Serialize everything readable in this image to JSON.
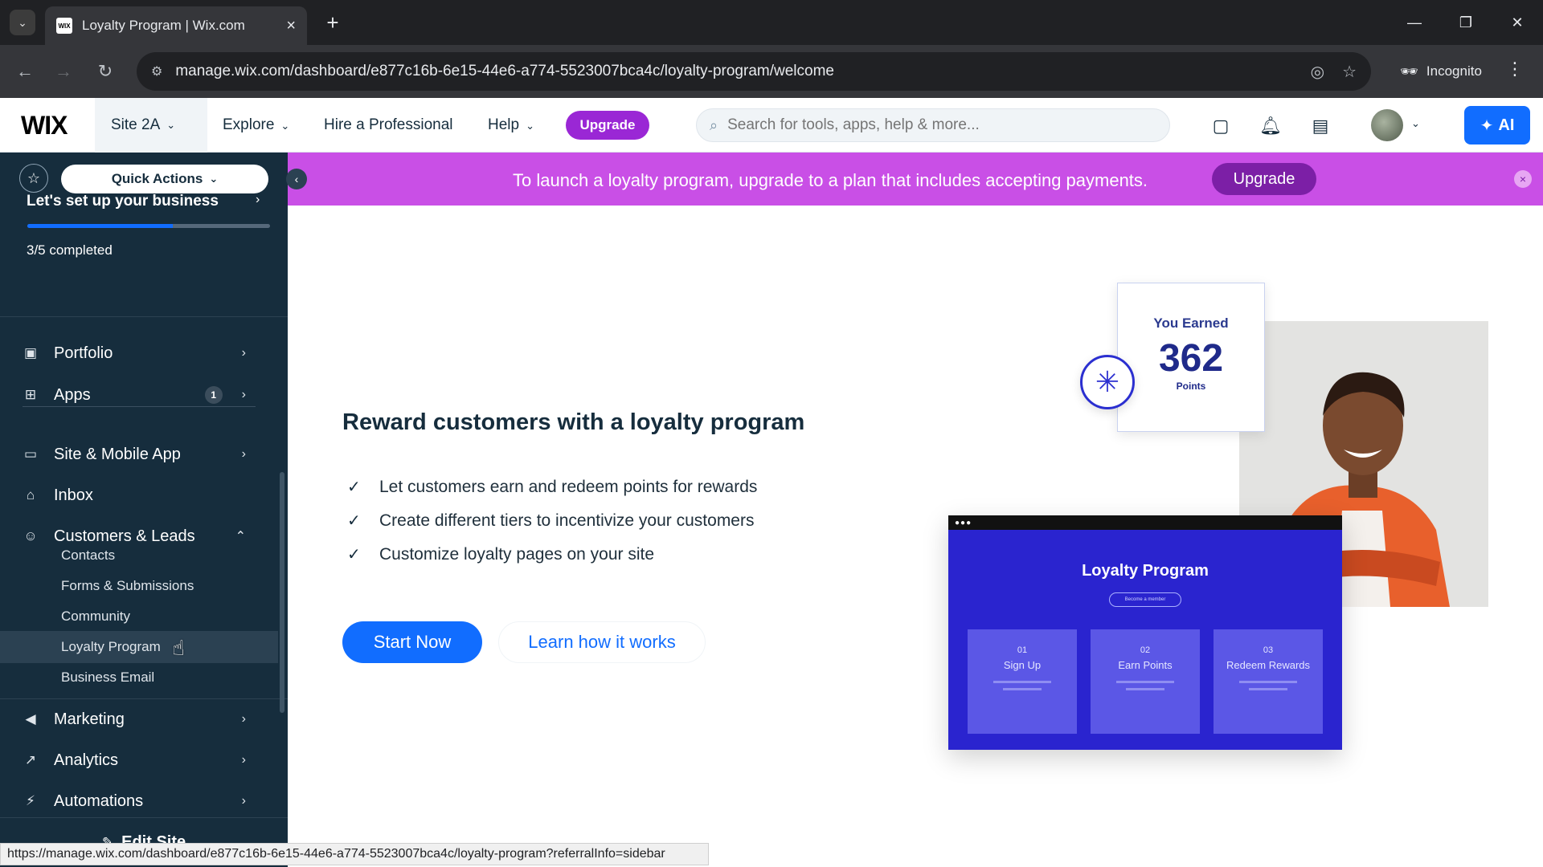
{
  "browser": {
    "tab_title": "Loyalty Program | Wix.com",
    "favicon_text": "WIX",
    "url": "manage.wix.com/dashboard/e877c16b-6e15-44e6-a774-5523007bca4c/loyalty-program/welcome",
    "incognito_label": "Incognito",
    "status_url": "https://manage.wix.com/dashboard/e877c16b-6e15-44e6-a774-5523007bca4c/loyalty-program?referralInfo=sidebar"
  },
  "topbar": {
    "logo": "WIX",
    "site_name": "Site 2A",
    "nav": [
      "Explore",
      "Hire a Professional",
      "Help"
    ],
    "upgrade_label": "Upgrade",
    "search_placeholder": "Search for tools, apps, help & more...",
    "ai_label": "AI"
  },
  "sidebar": {
    "quick_actions": "Quick Actions",
    "setup_title": "Let's set up your business",
    "setup_progress": 0.6,
    "setup_status": "3/5 completed",
    "items": [
      {
        "label": "Portfolio"
      },
      {
        "label": "Apps",
        "badge": "1"
      },
      {
        "label": "Site & Mobile App"
      },
      {
        "label": "Inbox"
      },
      {
        "label": "Customers & Leads"
      },
      {
        "label": "Marketing"
      },
      {
        "label": "Analytics"
      },
      {
        "label": "Automations"
      }
    ],
    "sub_items": [
      "Contacts",
      "Forms & Submissions",
      "Community",
      "Loyalty Program",
      "Business Email"
    ],
    "edit_site": "Edit Site"
  },
  "banner": {
    "text": "To launch a loyalty program, upgrade to a plan that includes accepting payments.",
    "upgrade_label": "Upgrade"
  },
  "main": {
    "title": "Reward customers with a loyalty program",
    "features": [
      "Let customers earn and redeem points for rewards",
      "Create different tiers to incentivize your customers",
      "Customize loyalty pages on your site"
    ],
    "start_label": "Start Now",
    "learn_label": "Learn how it works"
  },
  "illustration": {
    "earned_label": "You Earned",
    "earned_value": "362",
    "earned_unit": "Points",
    "lp_title": "Loyalty Program",
    "lp_pill": "Become a member",
    "steps": [
      {
        "num": "01",
        "name": "Sign Up"
      },
      {
        "num": "02",
        "name": "Earn Points"
      },
      {
        "num": "03",
        "name": "Redeem Rewards"
      }
    ]
  }
}
